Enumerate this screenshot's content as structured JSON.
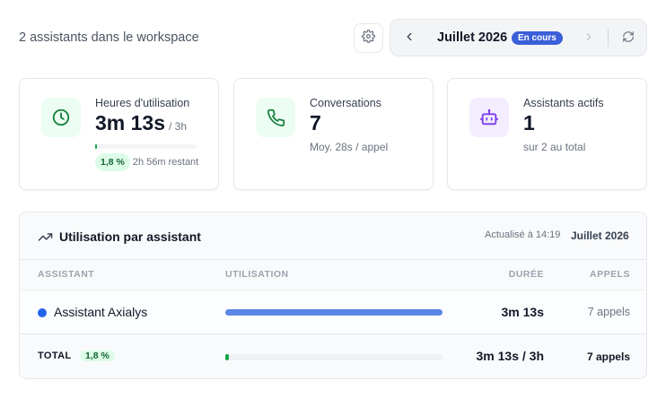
{
  "header": {
    "subtitle": "2 assistants dans le workspace",
    "period_label": "Juillet 2026",
    "period_badge": "En cours"
  },
  "cards": [
    {
      "label": "Heures d'utilisation",
      "value": "3m 13s",
      "unit": "/ 3h",
      "percent_label": "1,8 %",
      "percent_fraction": 0.018,
      "remaining": "2h 56m restant",
      "icon": "clock-icon",
      "accent": "#16a34a"
    },
    {
      "label": "Conversations",
      "value": "7",
      "sub": "Moy. 28s / appel",
      "icon": "phone-icon",
      "accent": "#16a34a"
    },
    {
      "label": "Assistants actifs",
      "value": "1",
      "sub": "sur 2 au total",
      "icon": "robot-icon",
      "accent": "#7c3aed"
    }
  ],
  "usage_table": {
    "title": "Utilisation par assistant",
    "updated": "Actualisé à 14:19",
    "month": "Juillet 2026",
    "columns": [
      "ASSISTANT",
      "UTILISATION",
      "DURÉE",
      "APPELS"
    ],
    "rows": [
      {
        "name": "Assistant Axialys",
        "usage_fraction": 1.0,
        "duration": "3m 13s",
        "calls": "7 appels",
        "color": "#2563eb"
      }
    ],
    "total": {
      "label": "TOTAL",
      "percent_label": "1,8 %",
      "usage_fraction": 0.018,
      "duration": "3m 13s / 3h",
      "calls": "7 appels"
    }
  },
  "colors": {
    "accent_blue": "#3b5fd9",
    "success_green": "#16a34a"
  }
}
